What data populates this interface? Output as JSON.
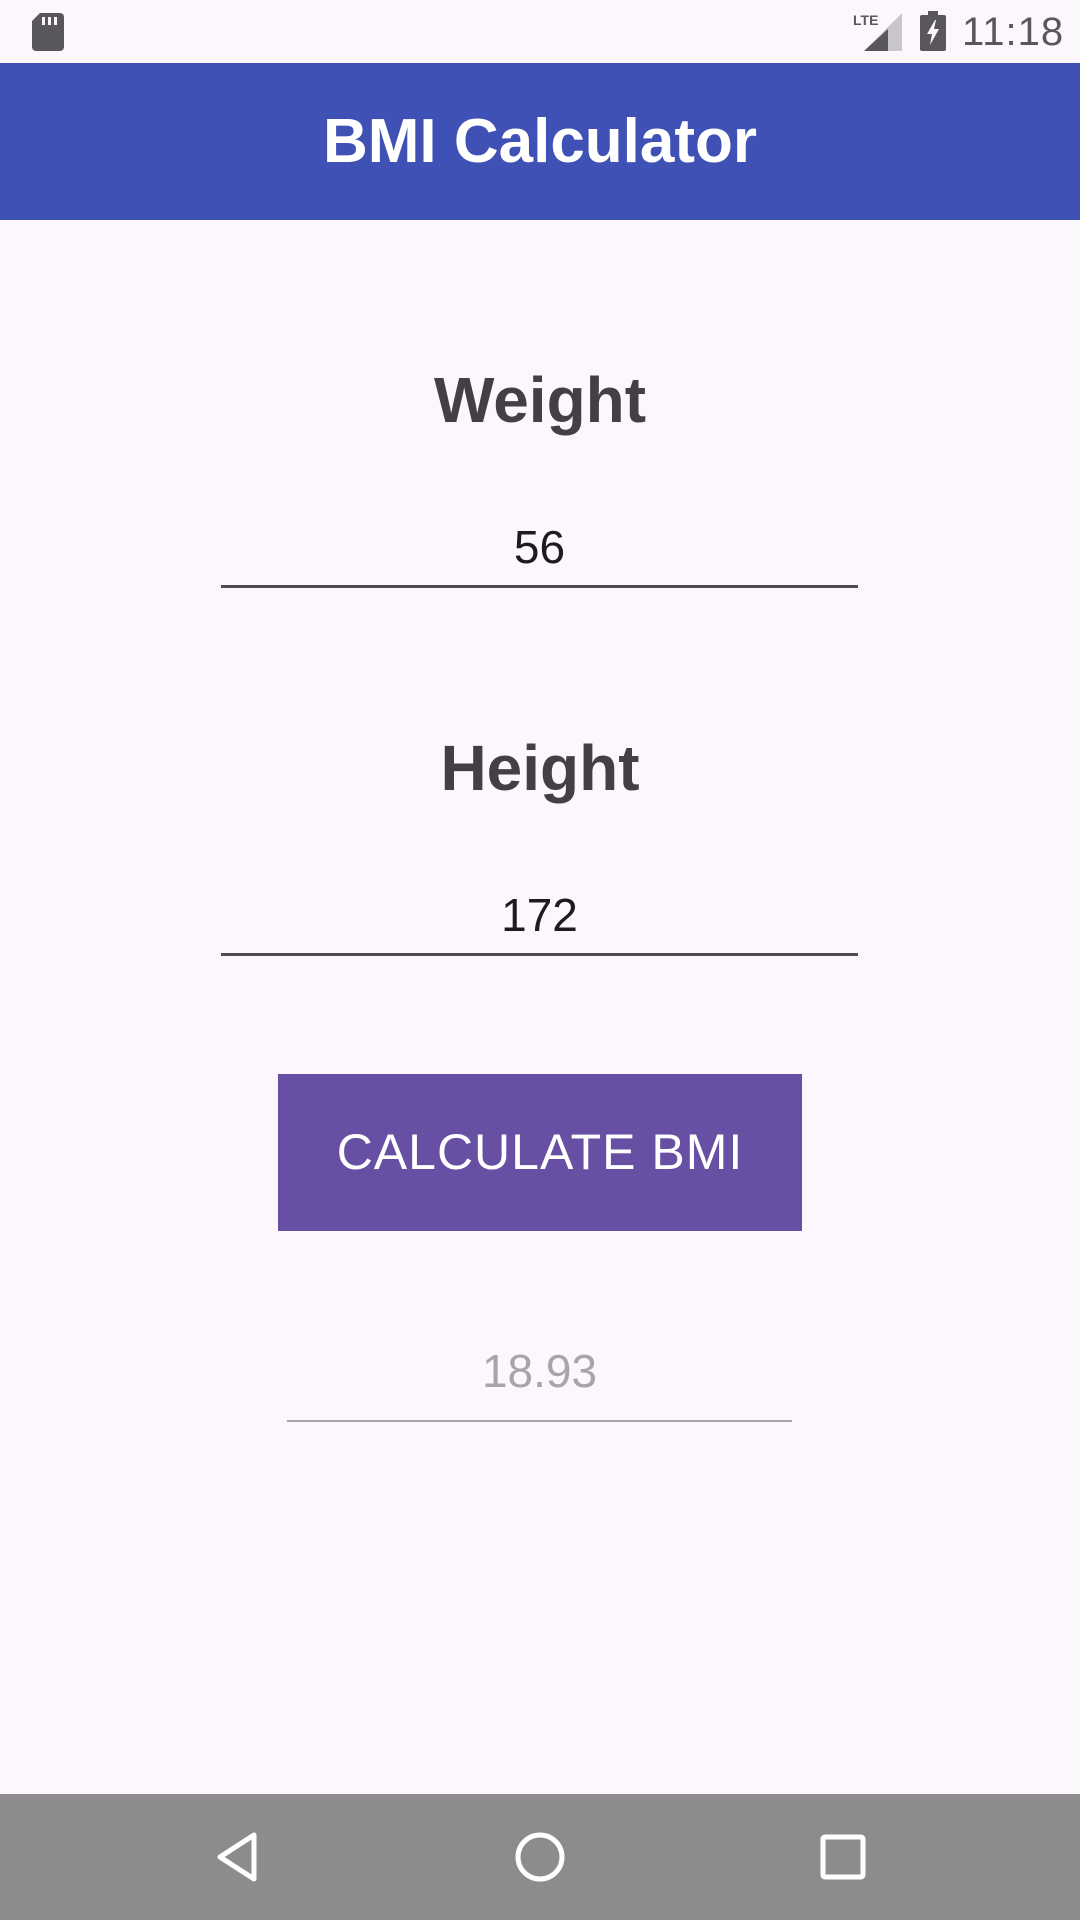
{
  "status_bar": {
    "time": "11:18",
    "network": "LTE",
    "icons": [
      "sd-card-icon",
      "lte-signal-icon",
      "battery-charging-icon"
    ]
  },
  "app_bar": {
    "title": "BMI Calculator"
  },
  "weight": {
    "label": "Weight",
    "value": "56"
  },
  "height": {
    "label": "Height",
    "value": "172"
  },
  "calculate_button": {
    "label": "CALCULATE BMI"
  },
  "result": {
    "value": "18.93"
  },
  "nav_bar": {
    "icons": [
      "back-icon",
      "home-icon",
      "recents-icon"
    ]
  },
  "colors": {
    "app_bar": "#3f51b5",
    "button": "#6750a4",
    "background": "#fcf6fd",
    "nav_bar": "#8e8b8f"
  }
}
